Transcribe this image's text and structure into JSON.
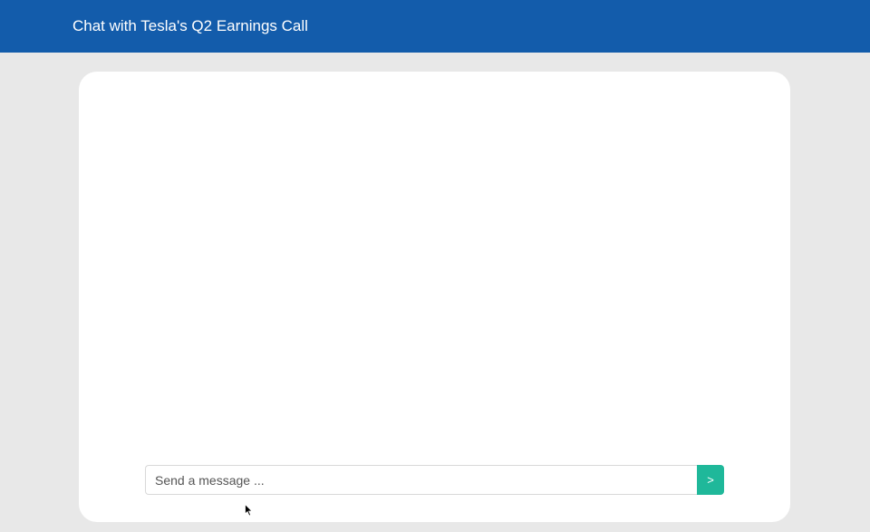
{
  "header": {
    "title": "Chat with Tesla's Q2 Earnings Call",
    "background_color": "#135cab"
  },
  "chat": {
    "messages": [],
    "input": {
      "value": "",
      "placeholder": "Send a message ..."
    },
    "send_button": {
      "label": ">",
      "color": "#1fb89a"
    }
  },
  "icons": {
    "cursor": "mouse-pointer-icon"
  }
}
